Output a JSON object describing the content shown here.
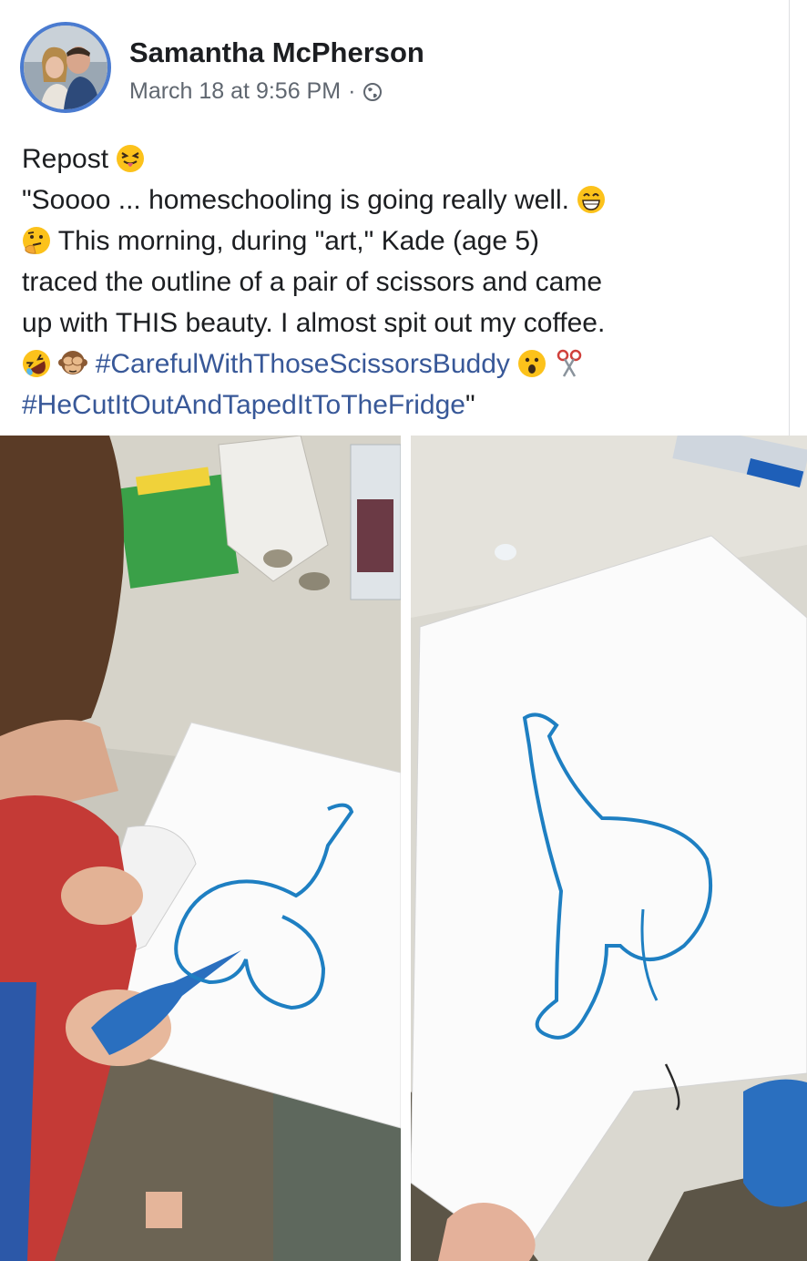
{
  "post": {
    "author": "Samantha McPherson",
    "timestamp": "March 18 at 9:56 PM",
    "separator": "·",
    "audience_icon": "globe-icon",
    "lines": {
      "l1": "Repost",
      "l2": "\"Soooo ... homeschooling is going really well.",
      "l3": "This morning, during \"art,\" Kade (age 5)",
      "l4": "traced the outline of a pair of scissors and came",
      "l5": "up with THIS beauty. I almost spit out my coffee.",
      "hashtag1": "#CarefulWithThoseScissorsBuddy",
      "hashtag2": "#HeCutItOutAndTapedItToTheFridge",
      "closing_quote": "\""
    },
    "emojis": [
      "squinting-tongue-emoji",
      "grinning-emoji",
      "thinking-emoji",
      "rofl-emoji",
      "see-no-evil-monkey-emoji",
      "surprised-emoji",
      "scissors-emoji"
    ]
  },
  "colors": {
    "hashtag": "#385898",
    "text": "#1c1e21",
    "meta": "#606770",
    "avatar_ring": "#4a7bd0",
    "drawing_ink": "#1e7fc2"
  },
  "photos": [
    "child-cutting-paper-photo",
    "traced-drawing-photo"
  ]
}
